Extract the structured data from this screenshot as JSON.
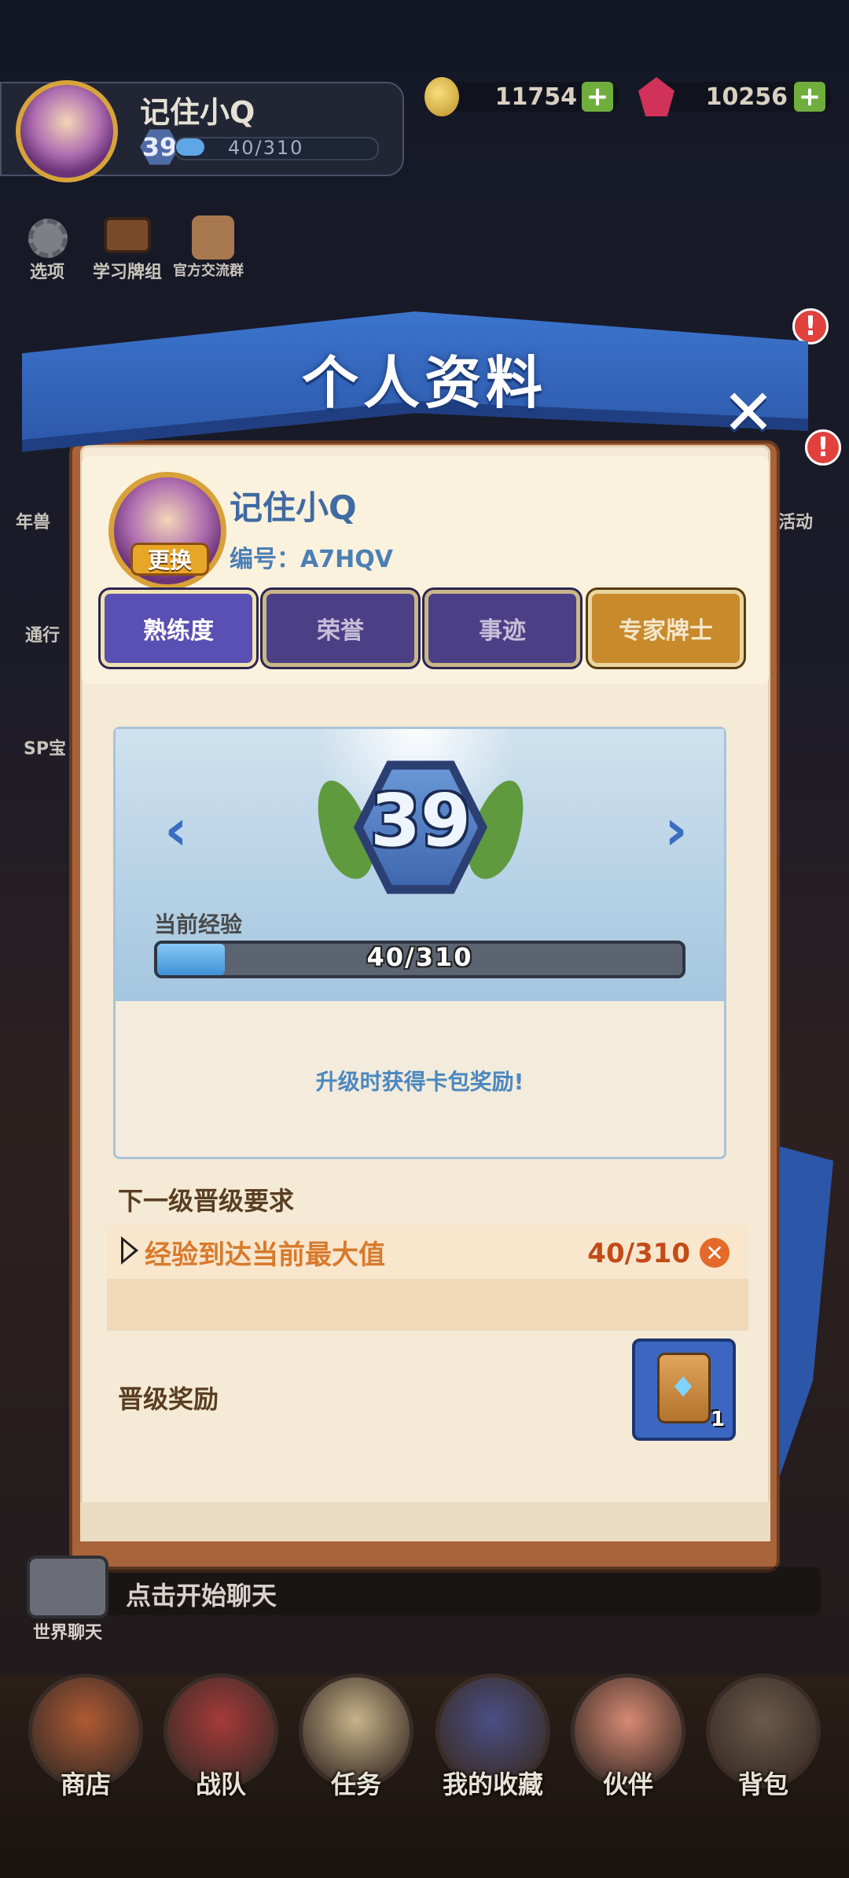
{
  "player": {
    "name": "记住小Q",
    "level": "39",
    "xp": "40/310"
  },
  "currency": {
    "coins": "11754",
    "gems": "10256",
    "plus": "+"
  },
  "top_menu": {
    "options": "选项",
    "study_deck": "学习牌组",
    "official_group": "官方交流群"
  },
  "side_menu": {
    "nian": "年兽",
    "pass": "通行",
    "sp": "SP宝",
    "event": "活动",
    "alert": "!"
  },
  "modal": {
    "title": "个人资料",
    "close": "✕",
    "change_avatar": "更换",
    "id_label": "编号：",
    "id_value": "A7HQV",
    "tabs": [
      {
        "label": "熟练度"
      },
      {
        "label": "荣誉"
      },
      {
        "label": "事迹"
      },
      {
        "label": "专家牌士"
      }
    ],
    "prev": "‹",
    "next": "›",
    "current_xp_label": "当前经验",
    "xp_fraction": 0.129,
    "reward_hint": "升级时获得卡包奖励!",
    "next_level_title": "下一级晋级要求",
    "requirement": {
      "text": "经验到达当前最大值",
      "value": "40/310",
      "status_icon": "✕"
    },
    "reward_title": "晋级奖励",
    "reward_count": "1"
  },
  "chat": {
    "placeholder": "点击开始聊天",
    "label": "世界聊天"
  },
  "bottom_nav": [
    {
      "label": "商店",
      "color": "#b05a34"
    },
    {
      "label": "战队",
      "color": "#a63a3a"
    },
    {
      "label": "任务",
      "color": "#c8b48a"
    },
    {
      "label": "我的收藏",
      "color": "#4a4f86"
    },
    {
      "label": "伙伴",
      "color": "#d88a74"
    },
    {
      "label": "背包",
      "color": "#6a5a4a"
    }
  ]
}
